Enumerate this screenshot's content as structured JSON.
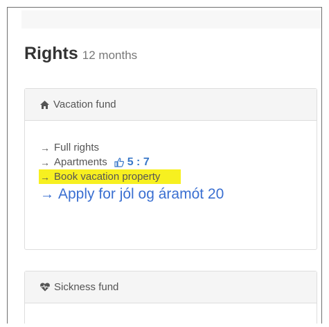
{
  "header": {
    "title": "Rights",
    "subtitle": "12 months"
  },
  "vacation_panel": {
    "icon": "home-icon",
    "heading": "Vacation fund",
    "links": [
      {
        "arrow": "→",
        "label": "Full rights"
      },
      {
        "arrow": "→",
        "label": "Apartments",
        "thumb_icon": "thumbs-up-icon",
        "count": "5 : 7"
      },
      {
        "arrow": "→",
        "label": "Book vacation property",
        "highlighted": true
      },
      {
        "arrow": "→",
        "label": "Apply for jól og áramót 20"
      }
    ]
  },
  "sickness_panel": {
    "icon": "heartbeat-icon",
    "heading": "Sickness fund"
  },
  "colors": {
    "accent": "#3a78c8",
    "highlight": "#f7f020",
    "panel_heading_bg": "#f5f5f5"
  }
}
